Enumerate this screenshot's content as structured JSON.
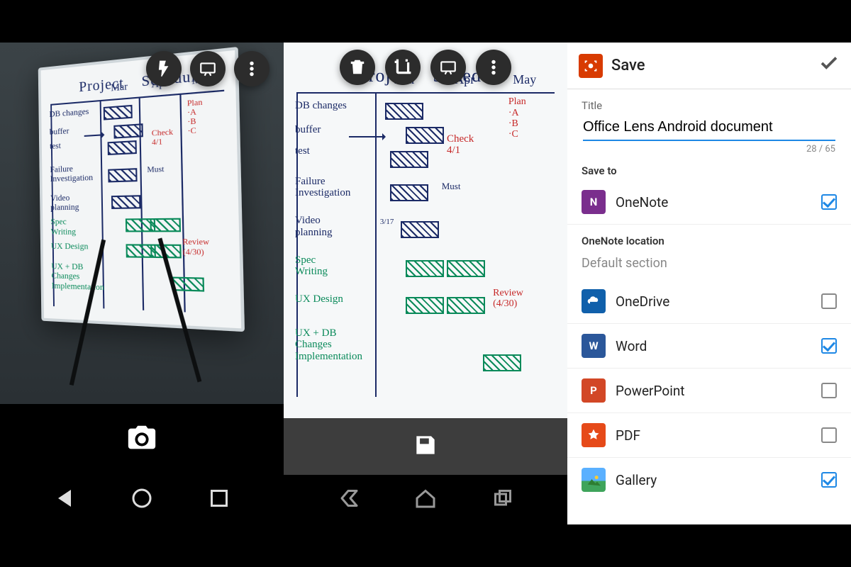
{
  "whiteboard": {
    "title1": "Project",
    "title2": "Schedule",
    "months": [
      "Mar",
      "Apr",
      "May"
    ],
    "rows": [
      {
        "label": "DB changes",
        "color": "blue"
      },
      {
        "label": "buffer",
        "color": "blue"
      },
      {
        "label": "test",
        "color": "blue"
      },
      {
        "label": "Failure\nInvestigation",
        "color": "blue"
      },
      {
        "label": "Video\nplanning",
        "color": "blue"
      },
      {
        "label": "Spec\nWriting",
        "color": "green"
      },
      {
        "label": "UX Design",
        "color": "green"
      },
      {
        "label": "UX + DB\nChanges\nImplementation",
        "color": "green"
      }
    ],
    "annotations": {
      "check": "Check\n4/1",
      "plan": "Plan\n·A\n·B\n·C",
      "must": "Must",
      "date_small": "3/17",
      "review": "Review\n(4/30)"
    }
  },
  "camera": {
    "icons": {
      "flash": "flash-icon",
      "mode": "whiteboard-mode-icon",
      "more": "more-icon",
      "shutter": "camera-icon"
    }
  },
  "crop": {
    "icons": {
      "delete": "trash-icon",
      "crop": "crop-icon",
      "mode": "whiteboard-mode-icon",
      "more": "more-icon",
      "save": "save-icon"
    }
  },
  "save": {
    "header": "Save",
    "title_label": "Title",
    "title_value": "Office Lens Android document",
    "char_count": "28 / 65",
    "save_to_label": "Save to",
    "onenote_loc_label": "OneNote location",
    "onenote_loc_value": "Default section",
    "targets": [
      {
        "id": "onenote",
        "label": "OneNote",
        "checked": true
      },
      {
        "id": "onedrive",
        "label": "OneDrive",
        "checked": false
      },
      {
        "id": "word",
        "label": "Word",
        "checked": true
      },
      {
        "id": "powerpoint",
        "label": "PowerPoint",
        "checked": false
      },
      {
        "id": "pdf",
        "label": "PDF",
        "checked": false
      },
      {
        "id": "gallery",
        "label": "Gallery",
        "checked": true
      }
    ]
  },
  "nav": {
    "back": "back-icon",
    "home": "home-icon",
    "recents": "recents-icon"
  }
}
